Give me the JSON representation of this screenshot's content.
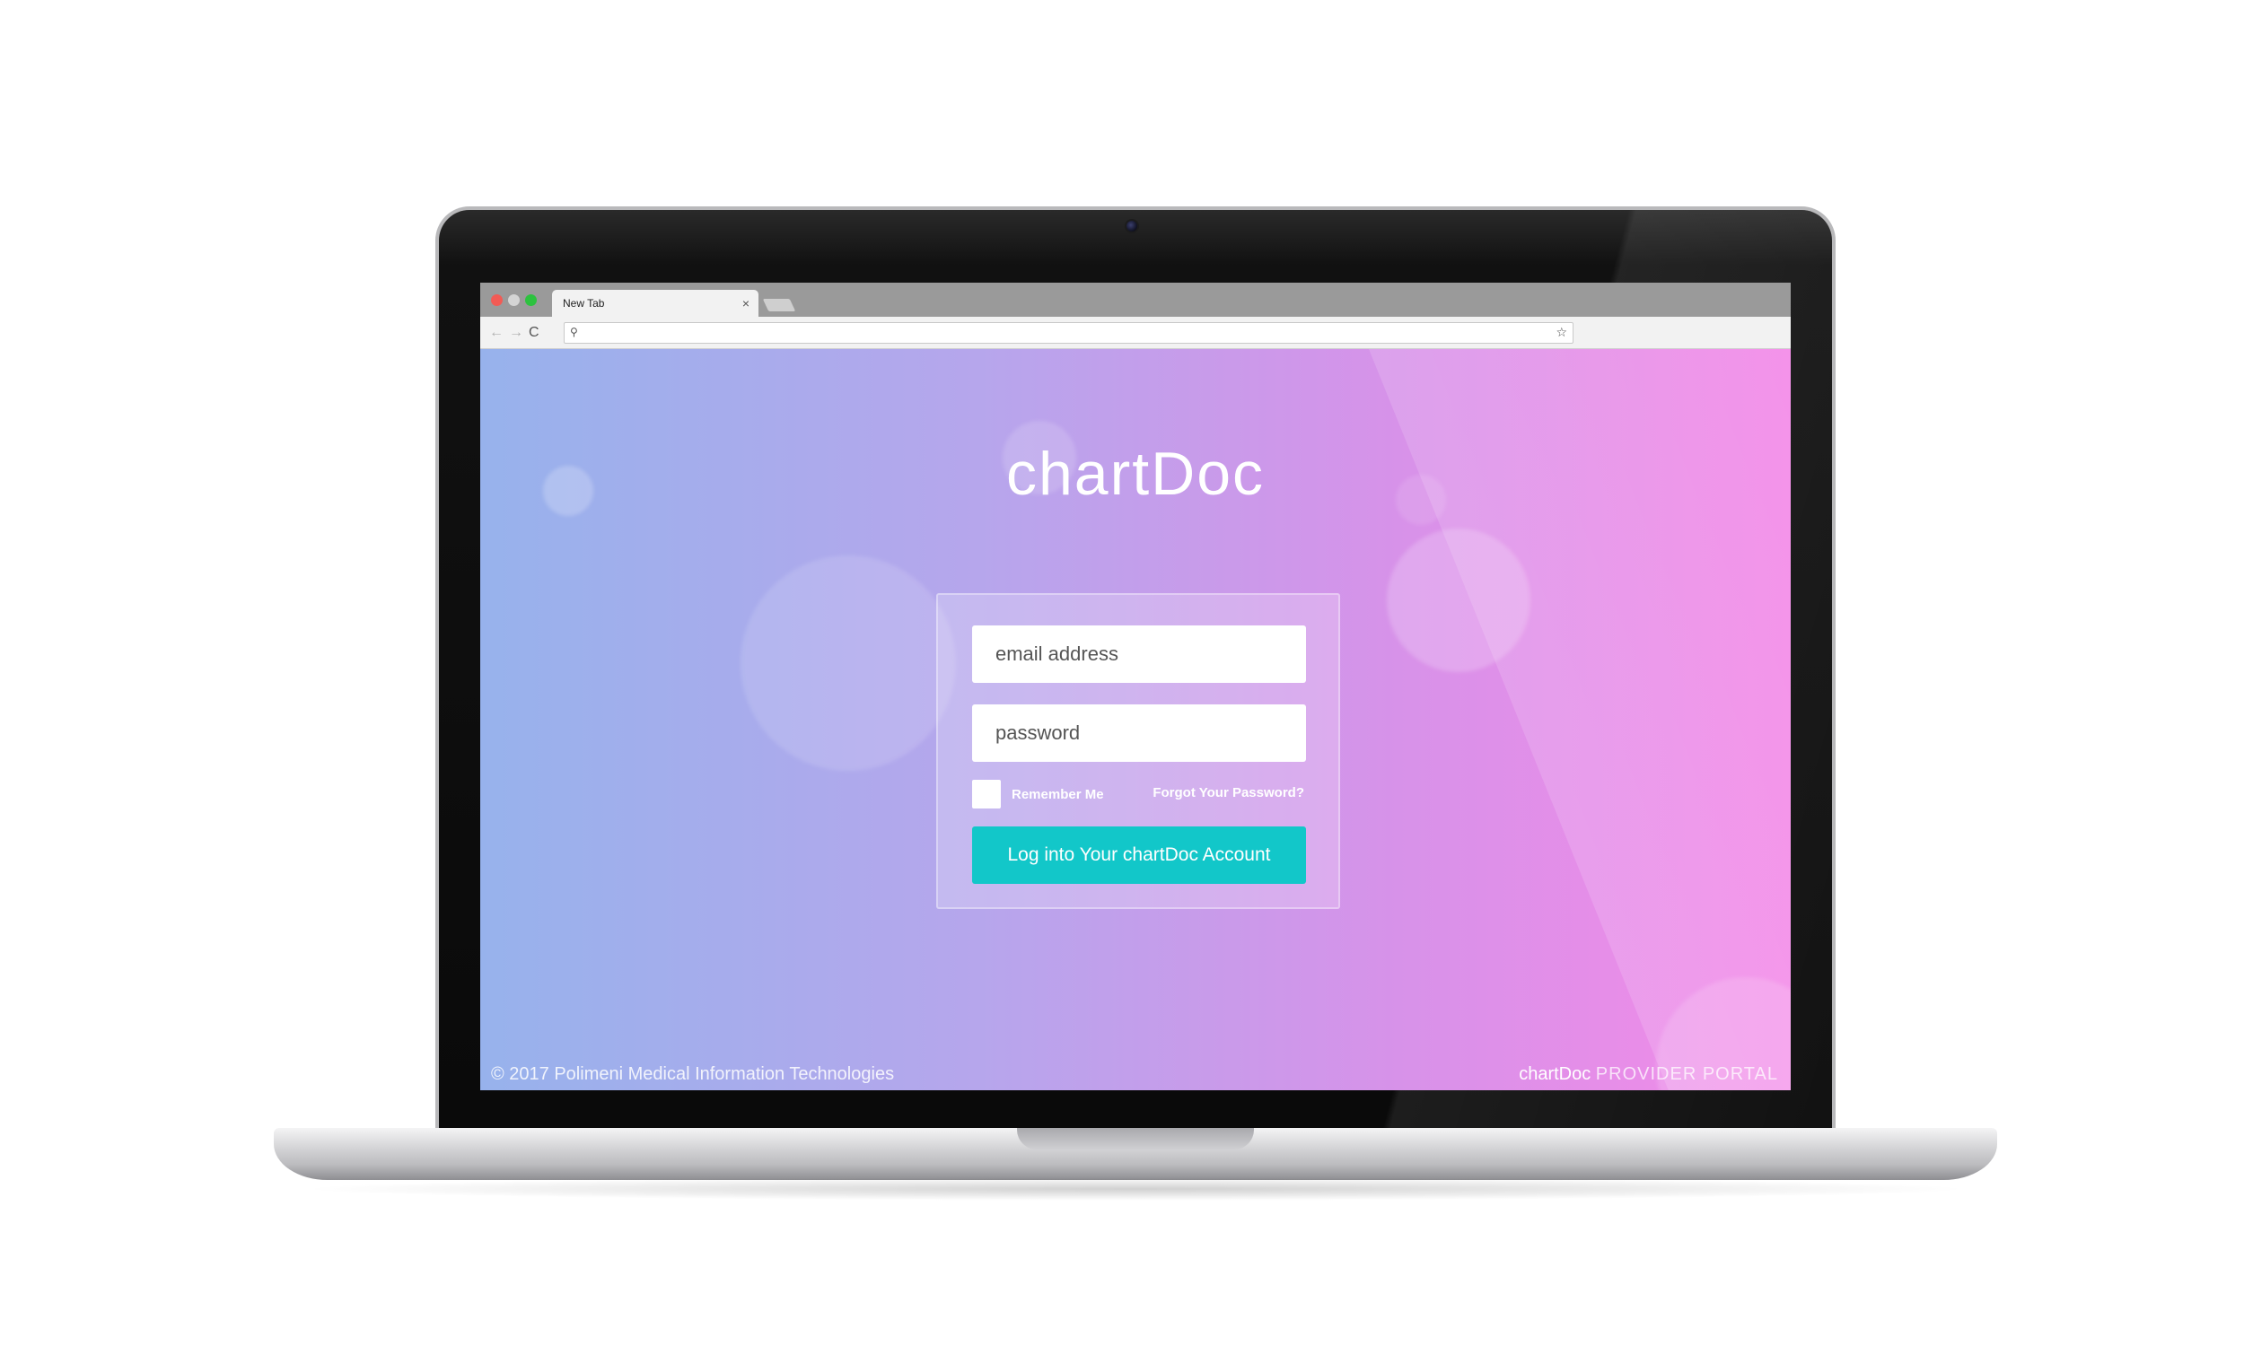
{
  "browser": {
    "tab_title": "New Tab",
    "tab_close": "×",
    "back": "←",
    "forward": "→",
    "reload": "C",
    "search_icon": "⚲",
    "star_icon": "☆",
    "omnibox_value": ""
  },
  "page": {
    "brand": "chartDoc",
    "email_placeholder": "email address",
    "password_placeholder": "password",
    "remember_label": "Remember Me",
    "forgot_label": "Forgot Your Password?",
    "login_button": "Log into Your chartDoc Account",
    "footer_copyright": "© 2017 Polimeni Medical Information Technologies",
    "footer_brand": "chartDoc",
    "footer_portal": "PROVIDER PORTAL"
  },
  "colors": {
    "accent_button": "#12c7c9",
    "gradient_start": "#97b2ec",
    "gradient_end": "#f38ae8"
  }
}
